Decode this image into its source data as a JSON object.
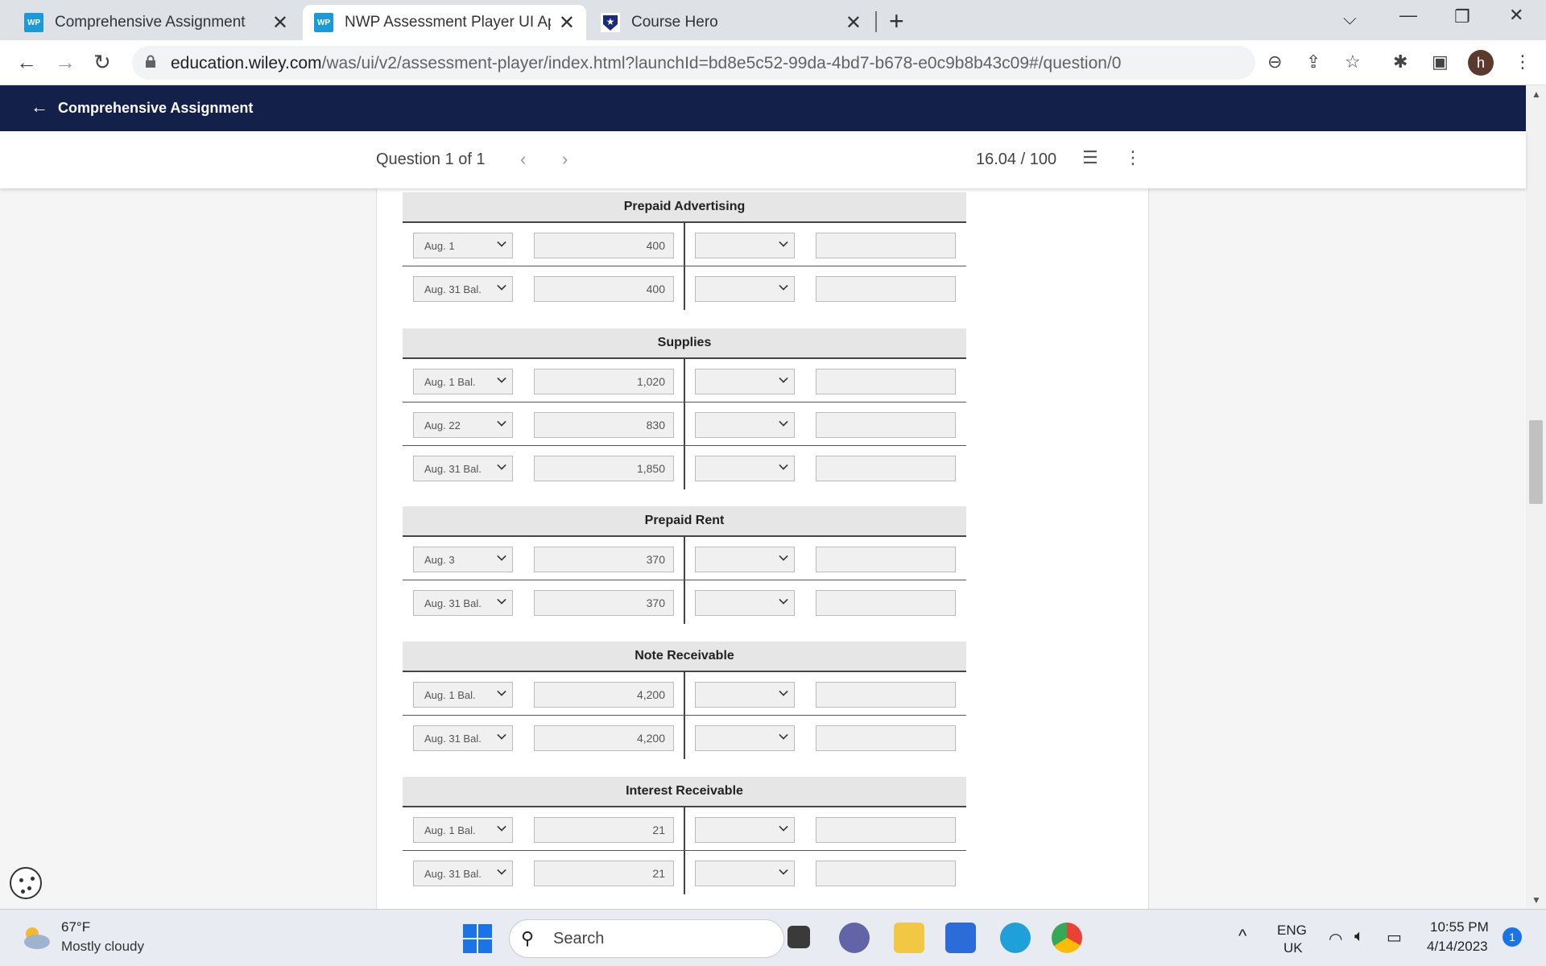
{
  "browser": {
    "tabs": [
      {
        "title": "Comprehensive Assignment",
        "favicon": "WP"
      },
      {
        "title": "NWP Assessment Player UI Appli",
        "favicon": "WP"
      },
      {
        "title": "Course Hero",
        "favicon": "star"
      }
    ],
    "url_host": "education.wiley.com",
    "url_path": "/was/ui/v2/assessment-player/index.html?launchId=bd8e5c52-99da-4bd7-b678-e0c9b8b43c09#/question/0",
    "profile_initial": "h"
  },
  "header": {
    "title": "Comprehensive Assignment"
  },
  "question_bar": {
    "label": "Question 1 of 1",
    "score": "16.04 / 100"
  },
  "accounts": [
    {
      "title": "Prepaid Advertising",
      "rows": [
        {
          "date": "Aug. 1",
          "debit": "400"
        },
        {
          "date": "Aug. 31 Bal.",
          "debit": "400"
        }
      ]
    },
    {
      "title": "Supplies",
      "rows": [
        {
          "date": "Aug. 1 Bal.",
          "debit": "1,020"
        },
        {
          "date": "Aug. 22",
          "debit": "830"
        },
        {
          "date": "Aug. 31 Bal.",
          "debit": "1,850"
        }
      ]
    },
    {
      "title": "Prepaid Rent",
      "rows": [
        {
          "date": "Aug. 3",
          "debit": "370"
        },
        {
          "date": "Aug. 31 Bal.",
          "debit": "370"
        }
      ]
    },
    {
      "title": "Note Receivable",
      "rows": [
        {
          "date": "Aug. 1 Bal.",
          "debit": "4,200"
        },
        {
          "date": "Aug. 31 Bal.",
          "debit": "4,200"
        }
      ]
    },
    {
      "title": "Interest Receivable",
      "rows": [
        {
          "date": "Aug. 1 Bal.",
          "debit": "21"
        },
        {
          "date": "Aug. 31 Bal.",
          "debit": "21"
        }
      ]
    }
  ],
  "taskbar": {
    "temperature": "67°F",
    "condition": "Mostly cloudy",
    "search_placeholder": "Search",
    "lang_top": "ENG",
    "lang_bottom": "UK",
    "time": "10:55 PM",
    "date": "4/14/2023",
    "notifications": "1"
  },
  "colors": {
    "header_bg": "#13214a",
    "wp_favicon": "#1a9bd7"
  }
}
